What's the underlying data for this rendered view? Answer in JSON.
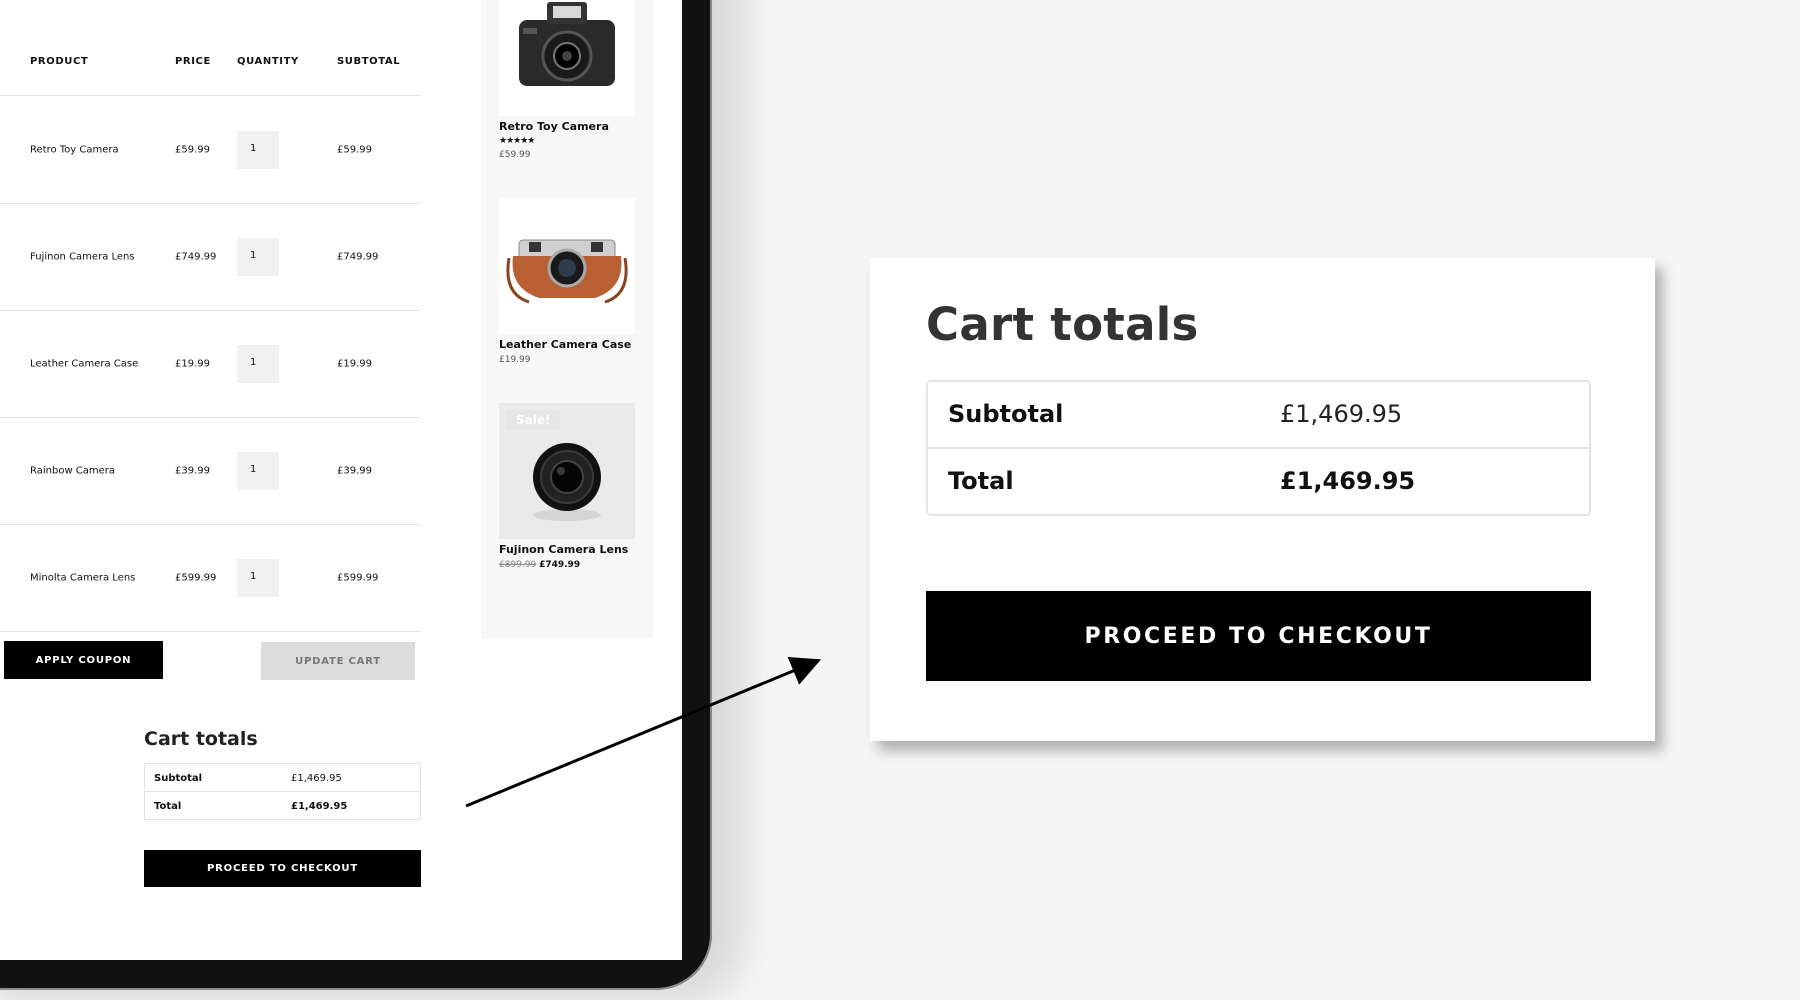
{
  "cart": {
    "headers": {
      "product": "PRODUCT",
      "price": "PRICE",
      "quantity": "QUANTITY",
      "subtotal": "SUBTOTAL"
    },
    "rows": [
      {
        "product": "Retro Toy Camera",
        "price": "£59.99",
        "qty": "1",
        "subtotal": "£59.99"
      },
      {
        "product": "Fujinon Camera Lens",
        "price": "£749.99",
        "qty": "1",
        "subtotal": "£749.99"
      },
      {
        "product": "Leather Camera Case",
        "price": "£19.99",
        "qty": "1",
        "subtotal": "£19.99"
      },
      {
        "product": "Rainbow Camera",
        "price": "£39.99",
        "qty": "1",
        "subtotal": "£39.99"
      },
      {
        "product": "Minolta Camera Lens",
        "price": "£599.99",
        "qty": "1",
        "subtotal": "£599.99"
      }
    ],
    "apply_coupon_label": "APPLY COUPON",
    "update_cart_label": "UPDATE CART"
  },
  "small_totals": {
    "title": "Cart totals",
    "subtotal_label": "Subtotal",
    "subtotal_value": "£1,469.95",
    "total_label": "Total",
    "total_value": "£1,469.95",
    "checkout_label": "PROCEED TO CHECKOUT"
  },
  "sidebar": {
    "products": [
      {
        "name": "Retro Toy Camera",
        "stars": "★★★★★",
        "price": "£59.99"
      },
      {
        "name": "Leather Camera Case",
        "price": "£19.99"
      },
      {
        "name": "Fujinon Camera Lens",
        "badge": "Sale!",
        "old_price": "£899.99",
        "new_price": "£749.99"
      }
    ]
  },
  "zoom": {
    "title": "Cart totals",
    "subtotal_label": "Subtotal",
    "subtotal_value": "£1,469.95",
    "total_label": "Total",
    "total_value": "£1,469.95",
    "checkout_label": "PROCEED TO CHECKOUT"
  },
  "colors": {
    "background": "#f5f5f5",
    "button": "#000000",
    "update_button": "#dcdcdc",
    "device_frame": "#111111"
  }
}
